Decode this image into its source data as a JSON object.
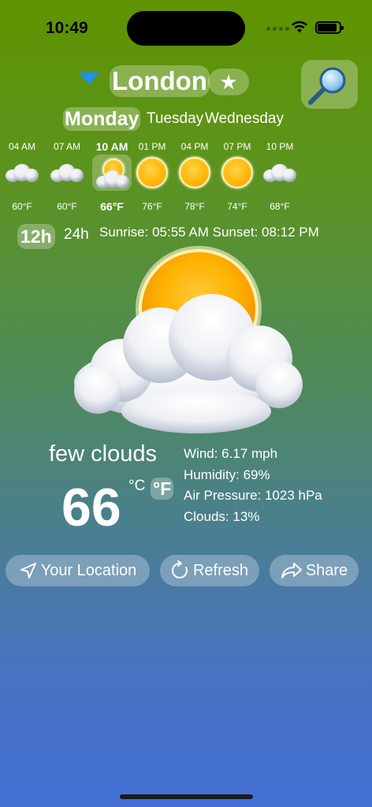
{
  "status_bar": {
    "time": "10:49"
  },
  "header": {
    "city": "London",
    "star_label": "★"
  },
  "days": [
    {
      "label": "Monday",
      "active": true
    },
    {
      "label": "Tuesday",
      "active": false
    },
    {
      "label": "Wednesday",
      "active": false
    }
  ],
  "hourly": [
    {
      "time": "04 AM",
      "temp": "60°F",
      "icon": "cloud-icon"
    },
    {
      "time": "07 AM",
      "temp": "60°F",
      "icon": "cloud-icon"
    },
    {
      "time": "10 AM",
      "temp": "66°F",
      "icon": "few-clouds-icon"
    },
    {
      "time": "01 PM",
      "temp": "76°F",
      "icon": "sun-icon"
    },
    {
      "time": "04 PM",
      "temp": "78°F",
      "icon": "sun-icon"
    },
    {
      "time": "07 PM",
      "temp": "74°F",
      "icon": "sun-icon"
    },
    {
      "time": "10 PM",
      "temp": "68°F",
      "icon": "cloud-icon"
    }
  ],
  "clock_format": {
    "option_12": "12h",
    "option_24": "24h"
  },
  "sun_times": "Sunrise: 05:55 AM Sunset: 08:12 PM",
  "current": {
    "description": "few clouds",
    "temp": "66",
    "unit_c": "°C",
    "unit_f": "°F",
    "wind": "Wind: 6.17 mph",
    "humidity": "Humidity: 69%",
    "pressure": "Air Pressure: 1023 hPa",
    "clouds": "Clouds: 13%"
  },
  "actions": {
    "location": "Your Location",
    "refresh": "Refresh",
    "share": "Share"
  },
  "colors": {
    "accent_dropdown": "#1e90ff",
    "bg_top": "#5f9300",
    "bg_bottom": "#4470d6"
  }
}
